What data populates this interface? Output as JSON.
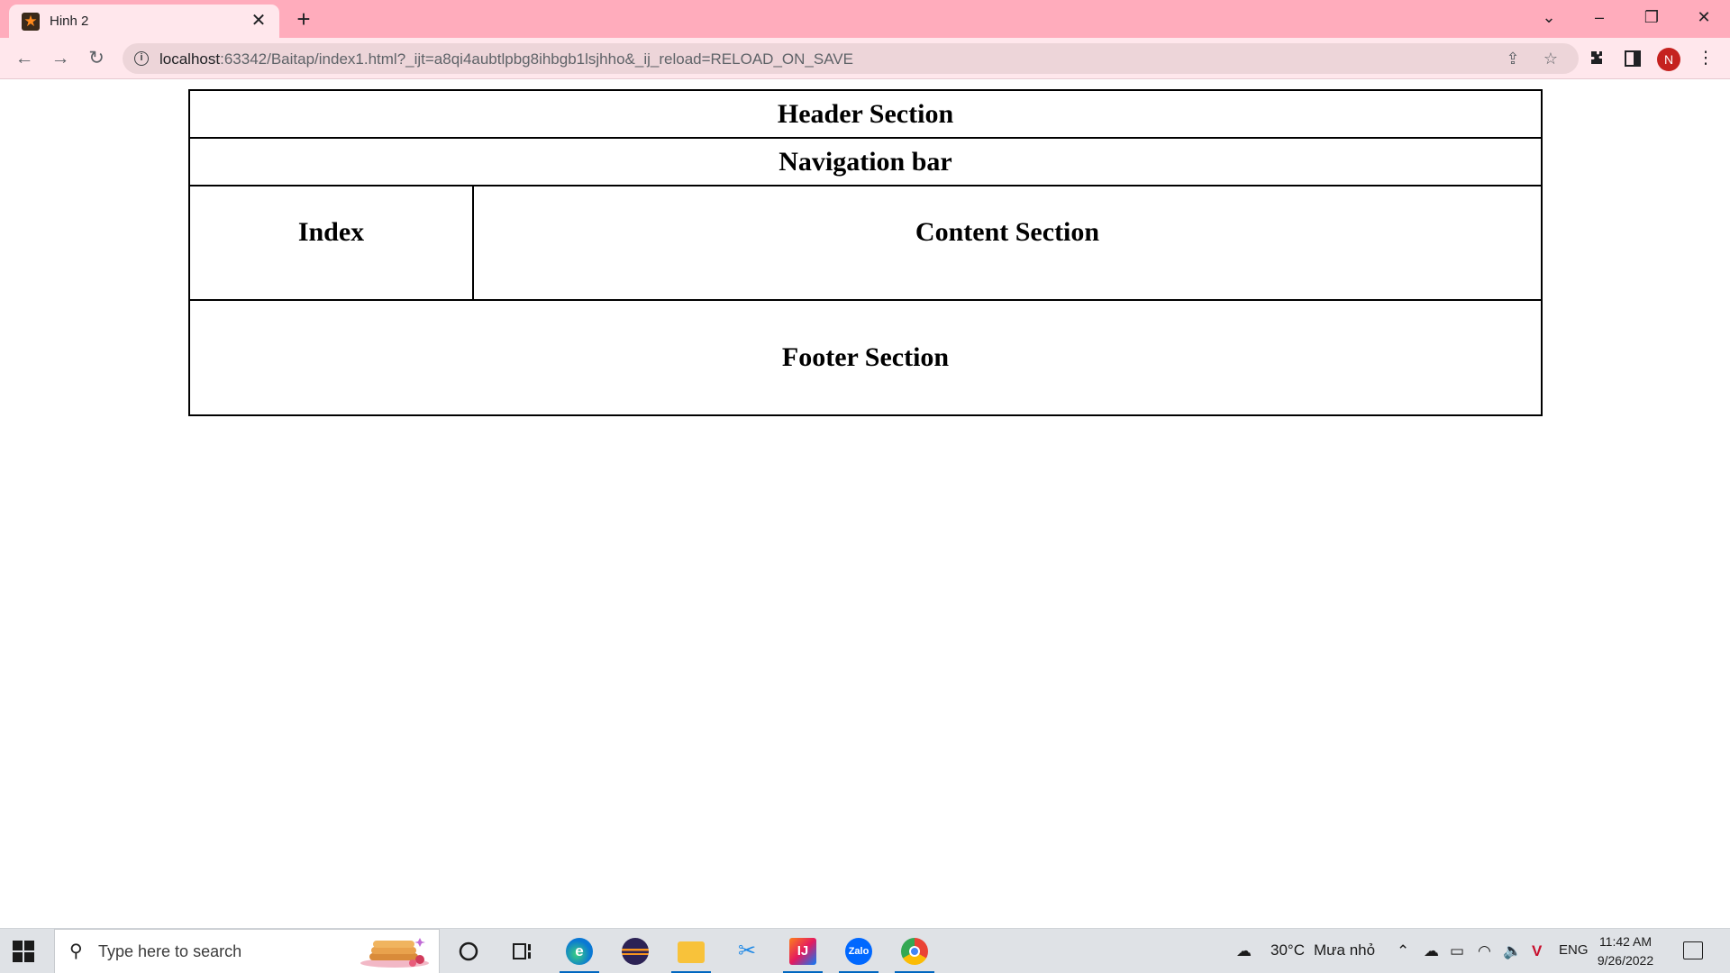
{
  "browser": {
    "tab_title": "Hinh 2",
    "url_host": "localhost",
    "url_rest": ":63342/Baitap/index1.html?_ijt=a8qi4aubtlpbg8ihbgb1lsjhho&_ij_reload=RELOAD_ON_SAVE",
    "profile_initial": "N",
    "accent_color": "#ffacbc"
  },
  "page": {
    "header": "Header Section",
    "nav": "Navigation bar",
    "index": "Index",
    "content": "Content Section",
    "footer": "Footer Section"
  },
  "taskbar": {
    "search_placeholder": "Type here to search",
    "weather_temp": "30°C",
    "weather_desc": "Mưa nhỏ",
    "language": "ENG",
    "time": "11:42 AM",
    "date": "9/26/2022",
    "apps": [
      "cortana-icon",
      "task-view-icon",
      "edge-icon",
      "eclipse-icon",
      "file-explorer-icon",
      "snipping-tool-icon",
      "intellij-icon",
      "zalo-icon",
      "chrome-icon"
    ],
    "zalo_label": "Zalo"
  }
}
